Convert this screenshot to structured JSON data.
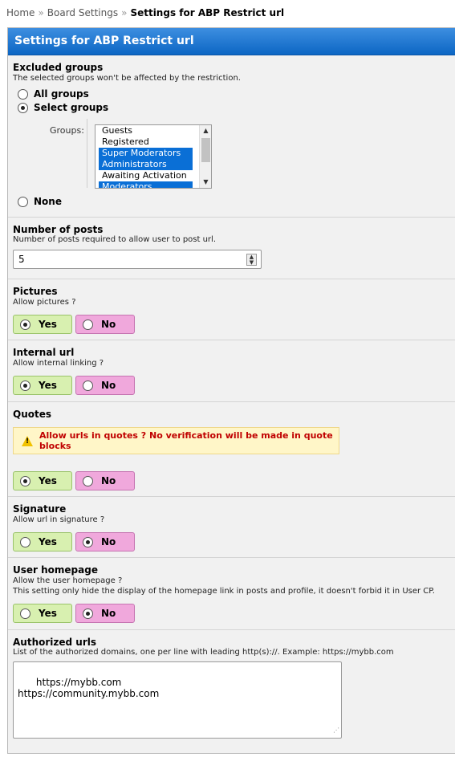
{
  "breadcrumb": {
    "home": "Home",
    "separator": "»",
    "board_settings": "Board Settings",
    "current": "Settings for ABP Restrict url"
  },
  "panel": {
    "title": "Settings for ABP Restrict url"
  },
  "excluded_groups": {
    "title": "Excluded groups",
    "description": "The selected groups won't be affected by the restriction.",
    "all_label": "All groups",
    "select_label": "Select groups",
    "none_label": "None",
    "selected": "select",
    "groups_label": "Groups:",
    "options": [
      {
        "label": "Guests",
        "selected": false
      },
      {
        "label": "Registered",
        "selected": false
      },
      {
        "label": "Super Moderators",
        "selected": true
      },
      {
        "label": "Administrators",
        "selected": true
      },
      {
        "label": "Awaiting Activation",
        "selected": false
      },
      {
        "label": "Moderators",
        "selected": true
      }
    ]
  },
  "posts": {
    "title": "Number of posts",
    "description": "Number of posts required to allow user to post url.",
    "value": "5"
  },
  "pictures": {
    "title": "Pictures",
    "description": "Allow pictures ?",
    "value": "yes"
  },
  "internal_url": {
    "title": "Internal url",
    "description": "Allow internal linking ?",
    "value": "yes"
  },
  "quotes": {
    "title": "Quotes",
    "warning": "Allow urls in quotes ? No verification will be made in quote blocks",
    "value": "yes"
  },
  "signature": {
    "title": "Signature",
    "description": "Allow url in signature ?",
    "value": "no"
  },
  "homepage": {
    "title": "User homepage",
    "description": "Allow the user homepage ?",
    "description2": "This setting only hide the display of the homepage link in posts and profile, it doesn't forbid it in User CP.",
    "value": "no"
  },
  "authorized": {
    "title": "Authorized urls",
    "description": "List of the authorized domains, one per line with leading http(s)://. Example: https://mybb.com",
    "value": "https://mybb.com\nhttps://community.mybb.com"
  },
  "labels": {
    "yes": "Yes",
    "no": "No"
  },
  "colors": {
    "header": "#0c66c4",
    "yes_bg": "#d8f0b0",
    "no_bg": "#f0a8dc",
    "warning_text": "#c00000"
  }
}
